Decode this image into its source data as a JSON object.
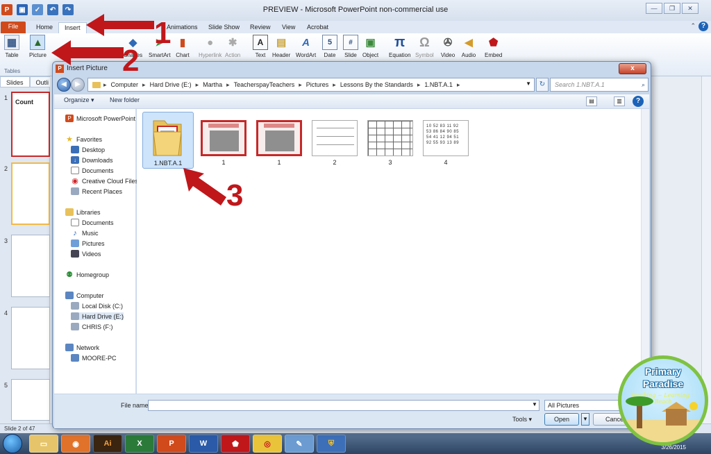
{
  "window": {
    "title": "PREVIEW - Microsoft PowerPoint non-commercial use"
  },
  "ribbon_tabs": [
    "File",
    "Home",
    "Insert",
    "Animations",
    "Slide Show",
    "Review",
    "View",
    "Acrobat"
  ],
  "ribbon": {
    "buttons": [
      "Table",
      "Picture",
      "Shapes",
      "SmartArt",
      "Chart",
      "Hyperlink",
      "Action",
      "Text",
      "Header",
      "WordArt",
      "Date",
      "Slide",
      "Object",
      "Equation",
      "Symbol",
      "Video",
      "Audio",
      "Embed"
    ],
    "group_tables": "Tables"
  },
  "slide_panel": {
    "tabs": [
      "Slides",
      "Outli"
    ],
    "slide_numbers": [
      "1",
      "2",
      "3",
      "4",
      "5"
    ],
    "slide1_text": "Count"
  },
  "status": "Slide 2 of 47",
  "dialog": {
    "title": "Insert Picture",
    "close": "x",
    "path": [
      "Computer",
      "Hard Drive (E:)",
      "Martha",
      "TeacherspayTeachers",
      "Pictures",
      "Lessons By the Standards",
      "1.NBT.A.1"
    ],
    "search_placeholder": "Search 1.NBT.A.1",
    "organize": "Organize ▾",
    "new_folder": "New folder",
    "nav": {
      "top": "Microsoft PowerPoint",
      "favorites": "Favorites",
      "favorites_items": [
        "Desktop",
        "Downloads",
        "Documents",
        "Creative Cloud Files",
        "Recent Places"
      ],
      "libraries": "Libraries",
      "libraries_items": [
        "Documents",
        "Music",
        "Pictures",
        "Videos"
      ],
      "homegroup": "Homegroup",
      "computer": "Computer",
      "computer_items": [
        "Local Disk (C:)",
        "Hard Drive (E:)",
        "CHRIS (F:)"
      ],
      "network": "Network",
      "network_items": [
        "MOORE-PC"
      ]
    },
    "files": [
      "1.NBT.A.1",
      "1",
      "1",
      "2",
      "3",
      "4"
    ],
    "file4_numbers": "10 52 83 11 92\n53 86 84 90 85\n54 41 12 94 51\n92 55 93 13 89",
    "file_name_label": "File name:",
    "file_name_value": "",
    "filter": "All Pictures",
    "tools": "Tools",
    "open": "Open",
    "cancel": "Cancel"
  },
  "annotations": [
    "1",
    "2",
    "3"
  ],
  "badge": {
    "line1": "Primary",
    "line2": "Paradise",
    "tagline": "Teaching ~ Learning ~ Beach"
  },
  "taskbar": {
    "apps": [
      "Explorer",
      "Firefox",
      "Ai",
      "Excel",
      "PowerPoint",
      "Word",
      "Acrobat",
      "Chrome",
      "Paint",
      "Shield"
    ],
    "date": "3/26/2015"
  },
  "colors": {
    "file_tab": "#d04a1c",
    "annotation_red": "#c0171b",
    "selection_blue": "#cde4fb"
  }
}
